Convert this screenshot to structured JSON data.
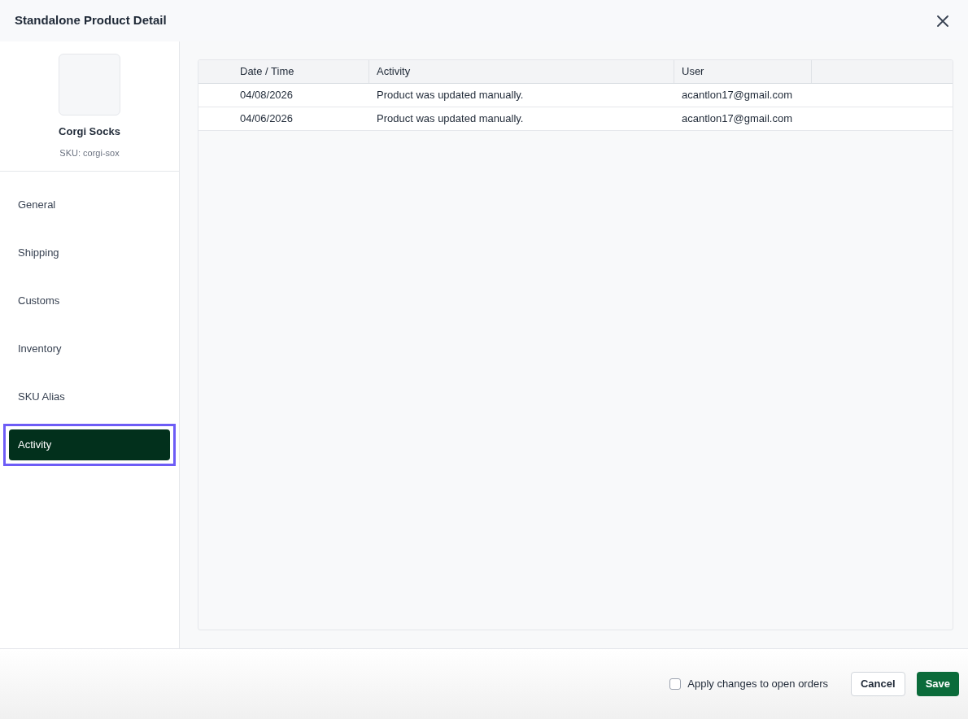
{
  "window": {
    "title": "Standalone Product Detail"
  },
  "product": {
    "name": "Corgi Socks",
    "sku": "SKU: corgi-sox"
  },
  "nav": [
    {
      "label": "General",
      "selected": false
    },
    {
      "label": "Shipping",
      "selected": false
    },
    {
      "label": "Customs",
      "selected": false
    },
    {
      "label": "Inventory",
      "selected": false
    },
    {
      "label": "SKU Alias",
      "selected": false
    },
    {
      "label": "Activity",
      "selected": true
    }
  ],
  "table": {
    "columns": [
      "Date / Time",
      "Activity",
      "User"
    ],
    "rows": [
      [
        "04/08/2026",
        "Product was updated manually.",
        "acantlon17@gmail.com"
      ],
      [
        "04/06/2026",
        "Product was updated manually.",
        "acantlon17@gmail.com"
      ]
    ]
  },
  "footer": {
    "apply_checkbox": {
      "label": "Apply changes to open orders",
      "checked": false
    },
    "buttons": [
      "Cancel",
      "Save"
    ]
  }
}
